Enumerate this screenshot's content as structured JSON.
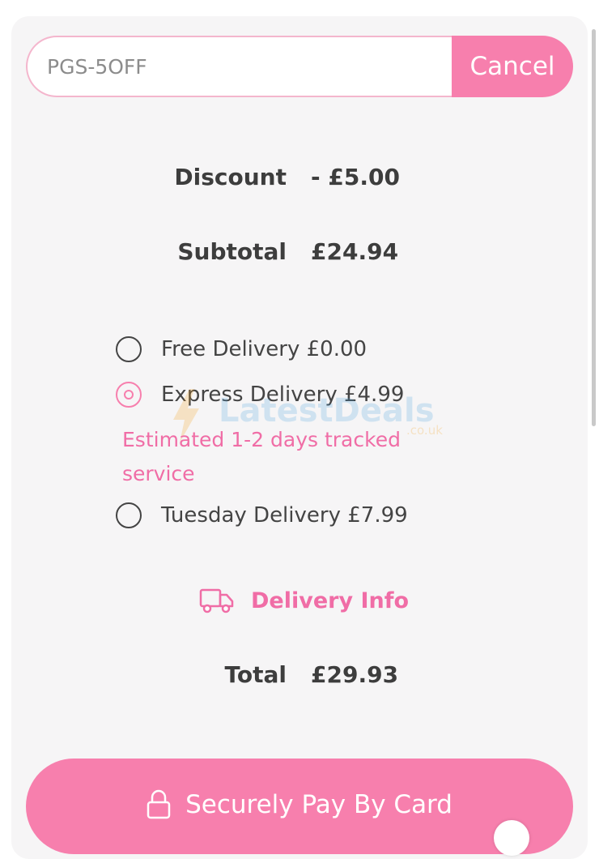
{
  "coupon": {
    "value": "PGS-5OFF",
    "cancel_label": "Cancel"
  },
  "summary": {
    "discount_label": "Discount",
    "discount_value": "- £5.00",
    "subtotal_label": "Subtotal",
    "subtotal_value": "£24.94"
  },
  "delivery": {
    "options": [
      {
        "label": "Free Delivery £0.00",
        "selected": false
      },
      {
        "label": "Express Delivery £4.99",
        "selected": true
      },
      {
        "label": "Tuesday Delivery £7.99",
        "selected": false
      }
    ],
    "express_note_line1": "Estimated 1-2 days tracked",
    "express_note_line2": "service",
    "info_label": "Delivery Info"
  },
  "total": {
    "label": "Total",
    "value": "£29.93"
  },
  "pay_button_label": "Securely Pay By Card",
  "watermark": {
    "text": "LatestDeals",
    "suffix": ".co.uk"
  },
  "colors": {
    "accent": "#f77fad",
    "accent_text": "#f06da6",
    "card_background": "#f6f5f6",
    "text_dark": "#3d3d3d"
  },
  "icons": {
    "delivery_info": "truck-icon",
    "pay_button": "lock-icon",
    "watermark": "lightning-bolt-icon"
  }
}
